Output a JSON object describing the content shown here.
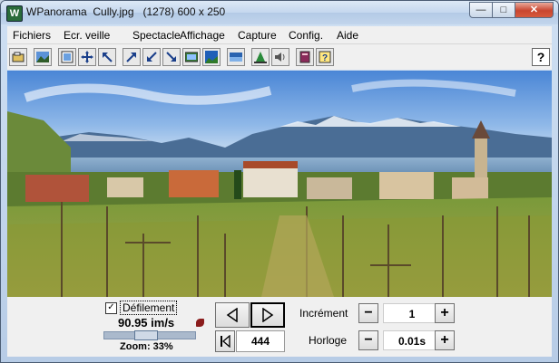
{
  "titlebar": {
    "title": "WPanorama  Cully.jpg   (1278) 600 x 250",
    "app_icon_glyph": "W",
    "minimize_glyph": "—",
    "maximize_glyph": "□",
    "close_glyph": "✕"
  },
  "menu": {
    "items": [
      "Fichiers",
      "Ecr. veille",
      "Spectacle",
      "Affichage",
      "Capture",
      "Config.",
      "Aide"
    ]
  },
  "toolbar": {
    "icons": [
      "open-icon",
      "picture-icon",
      "frame-icon",
      "move-icon",
      "zoom-in-icon",
      "expand-icon",
      "shrink-icon",
      "reduce-icon",
      "fit-window-icon",
      "landscape-icon",
      "horizon-icon",
      "pyramid-icon",
      "sound-icon",
      "book-icon",
      "help-doc-icon"
    ],
    "help_label": "?"
  },
  "colors": {
    "accent": "#3a6ea5",
    "sky": "#5b92d8",
    "mountain": "#3f5f86",
    "lake": "#6e93b8",
    "vineyard": "#6a8a2a"
  },
  "controls": {
    "scroll_checked": "✓",
    "scroll_label": "Défilement",
    "speed": "90.95 im/s",
    "zoom": "Zoom: 33%",
    "slider_fraction": 0.45,
    "prev_glyph": "◁",
    "next_glyph": "▷",
    "first_glyph": "|◁",
    "frame_value": "444",
    "increment_label": "Incrément",
    "increment_value": "1",
    "clock_label": "Horloge",
    "clock_value": "0.01s",
    "minus": "−",
    "plus": "+"
  }
}
